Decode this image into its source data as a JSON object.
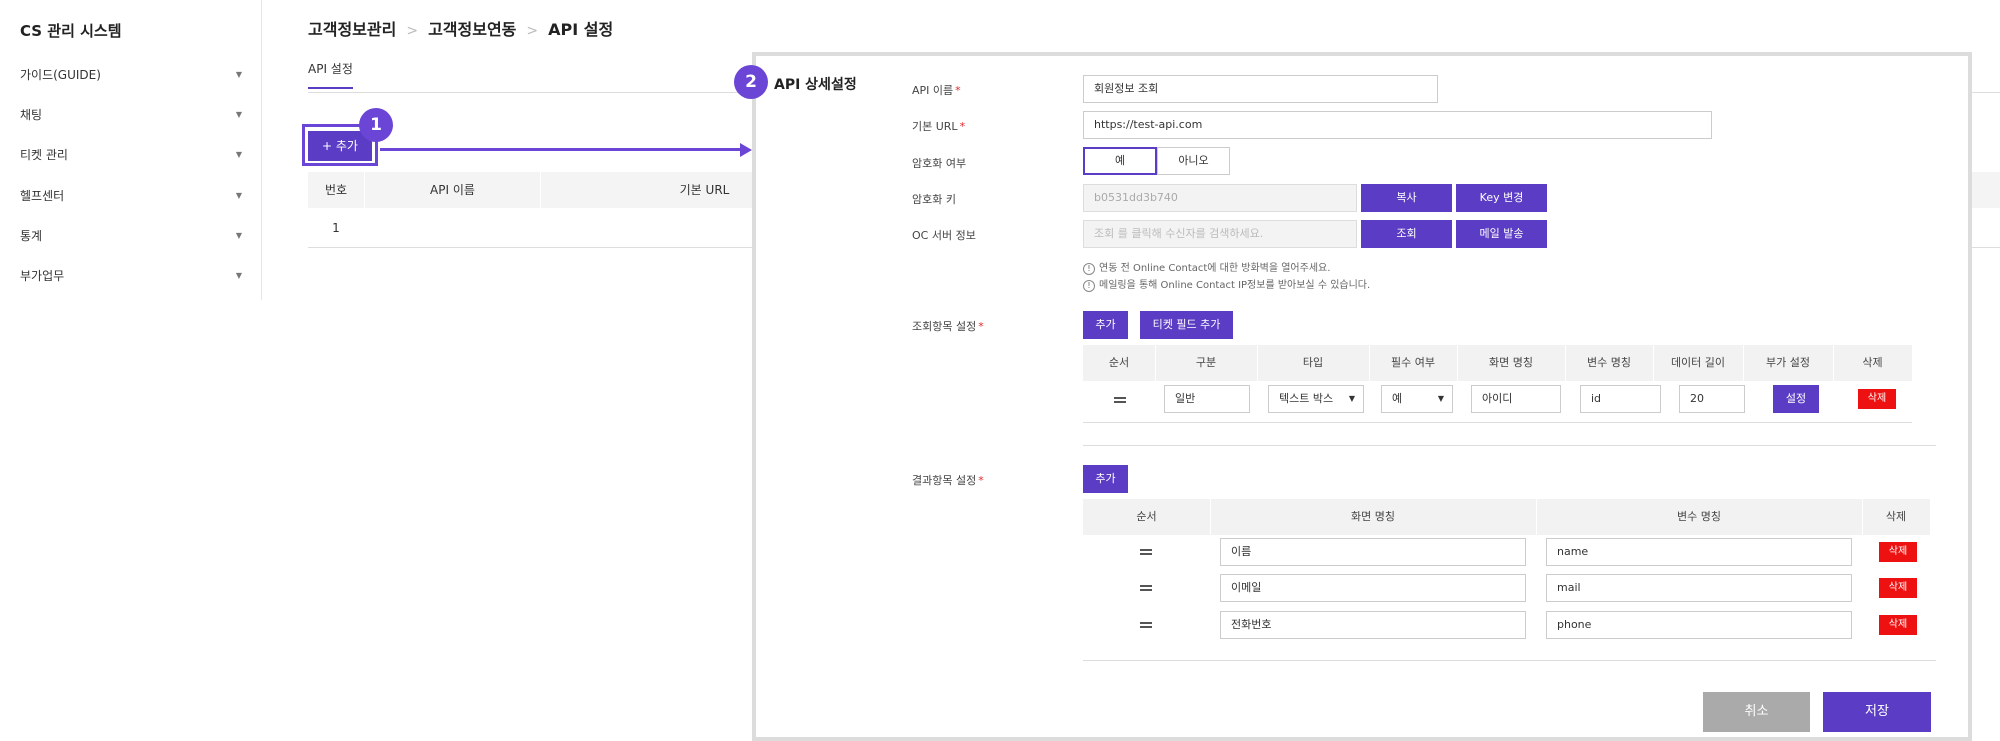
{
  "sidebar": {
    "title": "CS 관리 시스템",
    "items": [
      {
        "label": "가이드(GUIDE)"
      },
      {
        "label": "채팅"
      },
      {
        "label": "티켓 관리"
      },
      {
        "label": "헬프센터"
      },
      {
        "label": "통계"
      },
      {
        "label": "부가업무"
      }
    ]
  },
  "breadcrumb": [
    "고객정보관리",
    "고객정보연동",
    "API 설정"
  ],
  "tab": "API 설정",
  "add_button": "+ 추가",
  "badges": [
    "1",
    "2"
  ],
  "list_table": {
    "headers": [
      "번호",
      "API 이름",
      "기본 URL"
    ],
    "rows": [
      [
        "1"
      ]
    ]
  },
  "panel": {
    "title": "API 상세설정",
    "fields": {
      "api_name": {
        "label": "API 이름",
        "value": "회원정보 조회"
      },
      "base_url": {
        "label": "기본 URL",
        "value": "https://test-api.com"
      },
      "encryption": {
        "label": "암호화 여부",
        "yes": "예",
        "no": "아니오"
      },
      "enc_key": {
        "label": "암호화 키",
        "value": "b0531dd3b740",
        "copy": "복사",
        "change": "Key 변경"
      },
      "oc_server": {
        "label": "OC 서버 정보",
        "placeholder": "조회 를 클릭해 수신자를 검색하세요.",
        "search": "조회",
        "mail": "메일 발송"
      }
    },
    "notes": [
      "연동 전 Online Contact에 대한 방화벽을 열어주세요.",
      "메일링을 통해 Online Contact IP정보를 받아보실 수 있습니다."
    ],
    "query_section": {
      "label": "조회항목 설정",
      "add": "추가",
      "add_ticket": "티켓 필드 추가",
      "headers": [
        "순서",
        "구분",
        "타입",
        "필수 여부",
        "화면 명칭",
        "변수 명칭",
        "데이터 길이",
        "부가 설정",
        "삭제"
      ],
      "row": {
        "category": "일반",
        "type": "텍스트 박스",
        "required": "예",
        "display": "아이디",
        "variable": "id",
        "length": "20",
        "setting": "설정",
        "delete": "삭제"
      }
    },
    "result_section": {
      "label": "결과항목 설정",
      "add": "추가",
      "headers": [
        "순서",
        "화면 명칭",
        "변수 명칭",
        "삭제"
      ],
      "rows": [
        {
          "display": "이름",
          "variable": "name",
          "delete": "삭제"
        },
        {
          "display": "이메일",
          "variable": "mail",
          "delete": "삭제"
        },
        {
          "display": "전화번호",
          "variable": "phone",
          "delete": "삭제"
        }
      ]
    },
    "cancel": "취소",
    "save": "저장"
  }
}
